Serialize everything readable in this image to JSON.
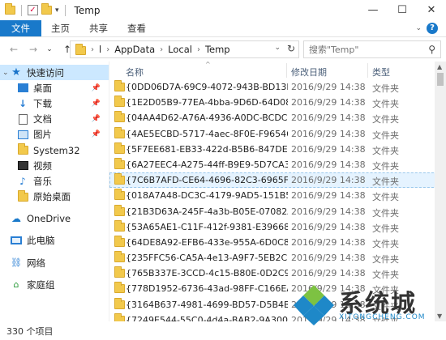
{
  "window": {
    "title": "Temp",
    "controls": {
      "minimize": "—",
      "maximize": "☐",
      "close": "✕"
    }
  },
  "ribbon": {
    "tabs": [
      "文件",
      "主页",
      "共享",
      "查看"
    ]
  },
  "address": {
    "crumbs": [
      "l",
      "AppData",
      "Local",
      "Temp"
    ]
  },
  "search": {
    "placeholder": "搜索\"Temp\""
  },
  "sidebar": {
    "quick_access": "快速访问",
    "quick_items": [
      {
        "label": "桌面",
        "icon": "desktop-icon",
        "pinned": true
      },
      {
        "label": "下载",
        "icon": "download-icon",
        "pinned": true
      },
      {
        "label": "文档",
        "icon": "document-icon",
        "pinned": true
      },
      {
        "label": "图片",
        "icon": "picture-icon",
        "pinned": true
      },
      {
        "label": "System32",
        "icon": "folder-icon",
        "pinned": false
      },
      {
        "label": "视频",
        "icon": "video-icon",
        "pinned": false
      },
      {
        "label": "音乐",
        "icon": "music-icon",
        "pinned": false
      },
      {
        "label": "原始桌面",
        "icon": "folder-icon",
        "pinned": false
      }
    ],
    "onedrive": "OneDrive",
    "this_pc": "此电脑",
    "network": "网络",
    "homegroup": "家庭组"
  },
  "columns": {
    "name": "名称",
    "date": "修改日期",
    "type": "类型"
  },
  "files": [
    {
      "name": "{0DD06D7A-69C9-4072-943B-BD13F2...",
      "date": "2016/9/29 14:38",
      "type": "文件夹"
    },
    {
      "name": "{1E2D05B9-77EA-4bba-9D6D-64D08F...",
      "date": "2016/9/29 14:38",
      "type": "文件夹"
    },
    {
      "name": "{04AA4D62-A76A-4936-A0DC-BCDCD...",
      "date": "2016/9/29 14:38",
      "type": "文件夹"
    },
    {
      "name": "{4AE5ECBD-5717-4aec-8F0E-F96546D...",
      "date": "2016/9/29 14:38",
      "type": "文件夹"
    },
    {
      "name": "{5F7EE681-EB33-422d-B5B6-847DE6...",
      "date": "2016/9/29 14:38",
      "type": "文件夹"
    },
    {
      "name": "{6A27EEC4-A275-44ff-B9E9-5D7CA3B...",
      "date": "2016/9/29 14:38",
      "type": "文件夹"
    },
    {
      "name": "{7C6B7AFD-CE64-4696-82C3-6965F9...",
      "date": "2016/9/29 14:38",
      "type": "文件夹"
    },
    {
      "name": "{018A7A48-DC3C-4179-9AD5-151B55...",
      "date": "2016/9/29 14:38",
      "type": "文件夹"
    },
    {
      "name": "{21B3D63A-245F-4a3b-B05E-07082A...",
      "date": "2016/9/29 14:38",
      "type": "文件夹"
    },
    {
      "name": "{53A65AE1-C11F-412f-9381-E396688...",
      "date": "2016/9/29 14:38",
      "type": "文件夹"
    },
    {
      "name": "{64DE8A92-EFB6-433e-955A-6D0C84...",
      "date": "2016/9/29 14:38",
      "type": "文件夹"
    },
    {
      "name": "{235FFC56-CA5A-4e13-A9F7-5EB2C00...",
      "date": "2016/9/29 14:38",
      "type": "文件夹"
    },
    {
      "name": "{765B337E-3CCD-4c15-B80E-0D2C99...",
      "date": "2016/9/29 14:38",
      "type": "文件夹"
    },
    {
      "name": "{778D1952-6736-43ad-98FF-C166EA7...",
      "date": "2016/9/29 14:38",
      "type": "文件夹"
    },
    {
      "name": "{3164B637-4981-4699-BD57-D5B4B9...",
      "date": "2016/9/29 14:38",
      "type": "文件夹"
    },
    {
      "name": "{7249E544-55C0-4d4a-BAB2-9A3007...",
      "date": "2016/9/29 14:38",
      "type": "文件夹"
    }
  ],
  "selected_index": 6,
  "status": {
    "count": "330 个项目"
  },
  "watermark": {
    "brand": "系统城",
    "url": "XITONGCHENG.COM"
  }
}
